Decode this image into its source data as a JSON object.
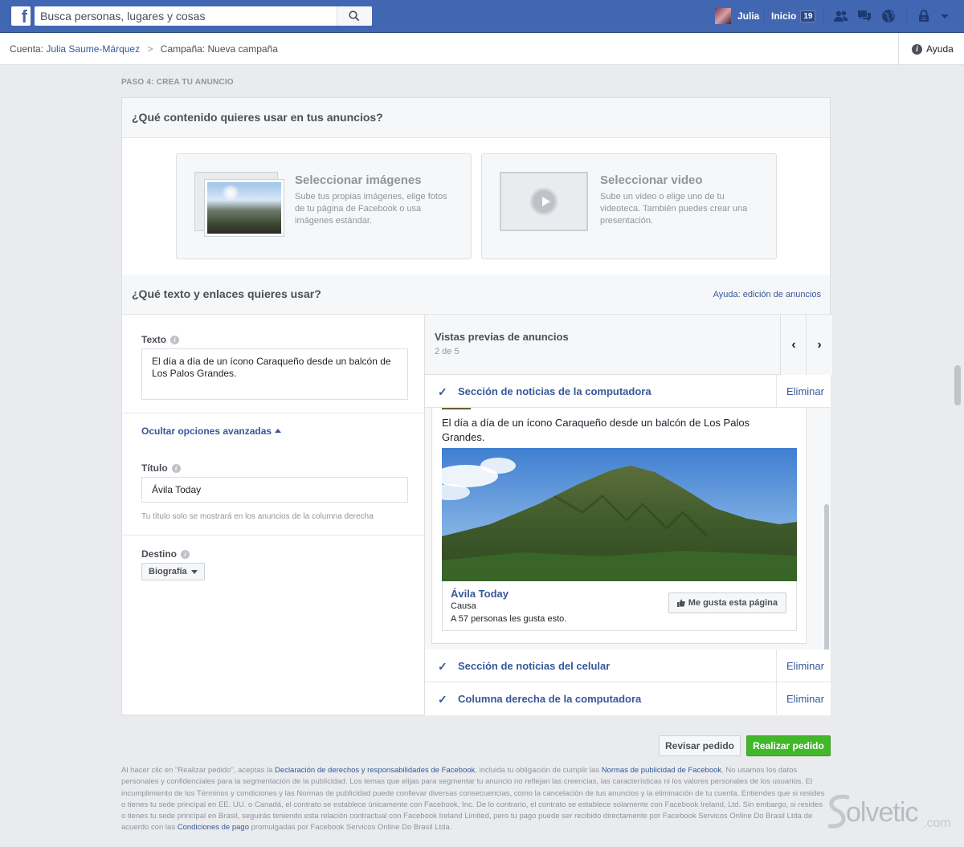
{
  "topbar": {
    "logo": "f",
    "search_placeholder": "Busca personas, lugares y cosas",
    "user_name": "Julia",
    "home_label": "Inicio",
    "home_count": "19",
    "icons": [
      "friend-requests-icon",
      "messages-icon",
      "notifications-globe-icon",
      "privacy-lock-icon",
      "account-menu-arrow-icon"
    ],
    "bar_color": "#4267b2"
  },
  "breadcrumb": {
    "account_label": "Cuenta:",
    "account_name": "Julia Saume-Márquez",
    "campaign_label": "Campaña:",
    "campaign_name": "Nueva campaña",
    "help_label": "Ayuda"
  },
  "step_label": "PASO 4: CREA TU ANUNCIO",
  "content_section": {
    "heading": "¿Qué contenido quieres usar en tus anuncios?",
    "images_card": {
      "title": "Seleccionar imágenes",
      "description": "Sube tus propias imágenes, elige fotos de tu página de Facebook o usa imágenes estándar."
    },
    "video_card": {
      "title": "Seleccionar video",
      "description": "Sube un video o elige uno de tu videoteca. También puedes crear una presentación."
    }
  },
  "text_section": {
    "heading": "¿Qué texto y enlaces quieres usar?",
    "help_link": "Ayuda: edición de anuncios",
    "text_label": "Texto",
    "text_value": "El día a día de un ícono Caraqueño desde un balcón de Los Palos Grandes.",
    "advanced_toggle": "Ocultar opciones avanzadas",
    "title_label": "Título",
    "title_value": "Ávila Today",
    "title_hint": "Tu título solo se mostrará en los anuncios de la columna derecha",
    "destination_label": "Destino",
    "destination_value": "Biografía"
  },
  "preview": {
    "title": "Vistas previas de anuncios",
    "count": "2 de 5",
    "prev_arrow": "‹",
    "next_arrow": "›",
    "rows": [
      {
        "label": "Sección de noticias de la computadora",
        "remove": "Eliminar"
      },
      {
        "label": "Sección de noticias del celular",
        "remove": "Eliminar"
      },
      {
        "label": "Columna derecha de la computadora",
        "remove": "Eliminar"
      }
    ],
    "ad": {
      "text": "El día a día de un ícono Caraqueño desde un balcón de Los Palos Grandes.",
      "page_name": "Ávila Today",
      "category": "Causa",
      "likes": "A 57 personas les gusta esto.",
      "like_button": "Me gusta esta página"
    }
  },
  "buttons": {
    "review": "Revisar pedido",
    "place_order": "Realizar pedido",
    "primary_color": "#42b72a"
  },
  "legal": {
    "p1": "Al hacer clic en \"Realizar pedido\", aceptas la ",
    "link1": "Declaración de derechos y responsabilidades de Facebook",
    "p2": ", incluida tu obligación de cumplir las ",
    "link2": "Normas de publicidad de Facebook",
    "p3": ". No usamos los datos personales y confidenciales para la segmentación de la publicidad. Los temas que elijas para segmentar tu anuncio no reflejan las creencias, las características ni los valores personales de los usuarios. El incumplimiento de los Términos y condiciones y las Normas de publicidad puede conllevar diversas consecuencias, como la cancelación de tus anuncios y la eliminación de tu cuenta. Entiendes que si resides o tienes tu sede principal en EE. UU. o Canadá, el contrato se establece únicamente con Facebook, Inc. De lo contrario, el contrato se establece solamente con Facebook Ireland, Ltd. Sin embargo, si resides o tienes tu sede principal en Brasil, seguirás teniendo esta relación contractual con Facebook Ireland Limited, pero tu pago puede ser recibido directamente por Facebook Servicos Online Do Brasil Ltda de acuerdo con las ",
    "link3": "Condiciones de pago",
    "p4": " promulgadas por Facebook Servicos Online Do Brasil Ltda."
  },
  "watermark": {
    "text": "olvetic",
    "suffix": ".com"
  }
}
